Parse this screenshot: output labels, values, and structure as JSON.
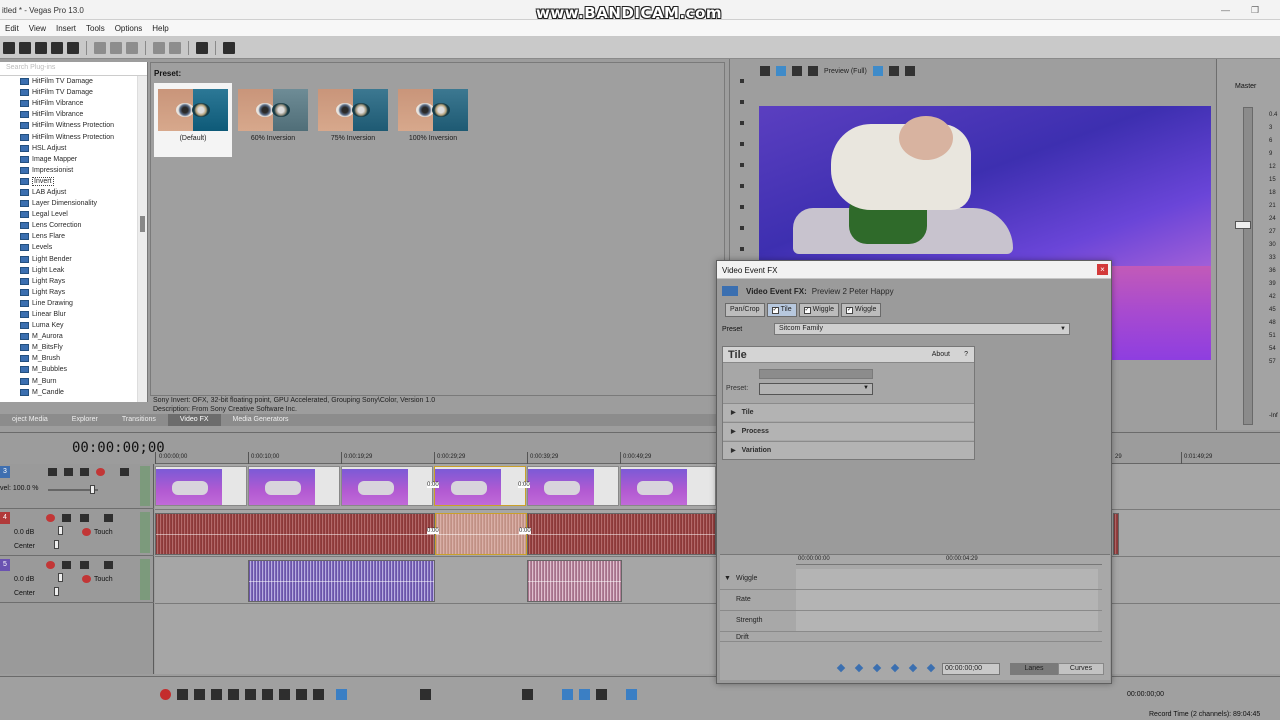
{
  "window": {
    "title": "itled * - Vegas Pro 13.0",
    "watermark": "www.BANDICAM.com"
  },
  "menu": [
    "Edit",
    "View",
    "Insert",
    "Tools",
    "Options",
    "Help"
  ],
  "fx_list": {
    "search_placeholder": "Search Plug-ins",
    "items": [
      "HitFilm TV Damage",
      "HitFilm TV Damage",
      "HitFilm Vibrance",
      "HitFilm Vibrance",
      "HitFilm Witness Protection",
      "HitFilm Witness Protection",
      "HSL Adjust",
      "Image Mapper",
      "Impressionist",
      "Invert",
      "LAB Adjust",
      "Layer Dimensionality",
      "Legal Level",
      "Lens Correction",
      "Lens Flare",
      "Levels",
      "Light Bender",
      "Light Leak",
      "Light Rays",
      "Light Rays",
      "Line Drawing",
      "Linear Blur",
      "Luma Key",
      "M_Aurora",
      "M_BitsFly",
      "M_Brush",
      "M_Bubbles",
      "M_Burn",
      "M_Candle"
    ],
    "selected_index": 9
  },
  "presets": {
    "label": "Preset:",
    "items": [
      {
        "label": "(Default)",
        "inversion": 0
      },
      {
        "label": "60% Inversion",
        "inversion": 60
      },
      {
        "label": "75% Inversion",
        "inversion": 75
      },
      {
        "label": "100% Inversion",
        "inversion": 100
      }
    ]
  },
  "description": {
    "line1": "Sony Invert: OFX, 32-bit floating point, GPU Accelerated, Grouping Sony\\Color, Version 1.0",
    "line2": "Description: From Sony Creative Software Inc."
  },
  "tabs": [
    "oject Media",
    "Explorer",
    "Transitions",
    "Video FX",
    "Media Generators"
  ],
  "active_tab": "Video FX",
  "preview": {
    "mode": "Preview (Full)"
  },
  "master": {
    "label": "Master",
    "scale": [
      "0.4",
      "3",
      "6",
      "9",
      "12",
      "15",
      "18",
      "21",
      "24",
      "27",
      "30",
      "33",
      "36",
      "39",
      "42",
      "45",
      "48",
      "51",
      "54",
      "57"
    ],
    "bottom": "-Inf"
  },
  "timeline": {
    "timecode": "00:00:00;00",
    "ruler": [
      "0:00:00;00",
      "0:00:10;00",
      "0:00:19;29",
      "0:00:29;29",
      "0:00:39;29",
      "0:00:49;29",
      "0:01:49;29"
    ],
    "ruler_right_partial": "29",
    "video_track": {
      "number": "3",
      "level": "vel: 100.0 %"
    },
    "audio_track_1": {
      "number": "4",
      "volume": "0.0 dB",
      "pan": "Center",
      "mode": "Touch"
    },
    "audio_track_2": {
      "number": "5",
      "volume": "0.0 dB",
      "pan": "Center",
      "mode": "Touch"
    },
    "clip_labels": [
      "0:00",
      "0:00",
      "0:00",
      "0:00"
    ]
  },
  "transport": {
    "time_right": "00:00:00;00",
    "record_time": "Record Time (2 channels): 89:04:45"
  },
  "dialog": {
    "title": "Video Event FX",
    "header_label": "Video Event FX:",
    "header_value": "Preview 2 Peter Happy",
    "chain": [
      {
        "label": "Pan/Crop",
        "checked": false
      },
      {
        "label": "Tile",
        "checked": true,
        "active": true
      },
      {
        "label": "Wiggle",
        "checked": true
      },
      {
        "label": "Wiggle",
        "checked": true
      }
    ],
    "preset_label": "Preset",
    "preset_value": "Sitcom Family",
    "plugin": {
      "name": "Tile",
      "about": "About",
      "help": "?",
      "preset_label": "Preset:",
      "sections": [
        "Tile",
        "Process",
        "Variation"
      ]
    },
    "keyframes": {
      "ruler": [
        "00:00:00:00",
        "00:00:04:29"
      ],
      "rows": [
        "Wiggle",
        "Rate",
        "Strength",
        "Drift"
      ],
      "time": "00:00:00;00",
      "lanes_label": "Lanes",
      "curves_label": "Curves"
    }
  }
}
